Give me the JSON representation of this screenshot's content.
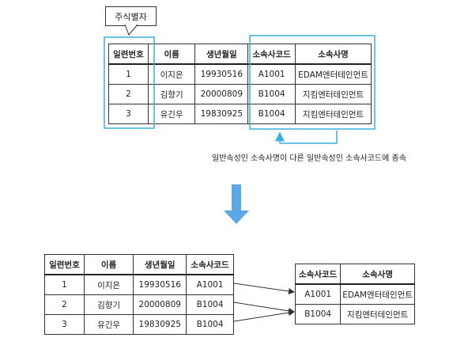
{
  "callout_label": "주식별자",
  "dependency_note": "일반속성인 소속사명이 다른 일반속성인 소속사코드에 종속",
  "colors": {
    "highlight": "#3ab0e0",
    "arrow": "#5aa9e6",
    "line": "#333333"
  },
  "icons": {
    "transform_arrow": "arrow-down-icon"
  },
  "top_table": {
    "headers": [
      "일련번호",
      "이름",
      "생년월일",
      "소속사코드",
      "소속사명"
    ],
    "rows": [
      [
        "1",
        "이지은",
        "19930516",
        "A1001",
        "EDAM엔터테인먼트"
      ],
      [
        "2",
        "김향기",
        "20000809",
        "B1004",
        "지킴엔터테인먼트"
      ],
      [
        "3",
        "유긴우",
        "19830925",
        "B1004",
        "지킴엔터테인먼트"
      ]
    ]
  },
  "bottom_left_table": {
    "headers": [
      "일련번호",
      "이름",
      "생년월일",
      "소속사코드"
    ],
    "rows": [
      [
        "1",
        "이지은",
        "19930516",
        "A1001"
      ],
      [
        "2",
        "김향기",
        "20000809",
        "B1004"
      ],
      [
        "3",
        "유긴우",
        "19830925",
        "B1004"
      ]
    ]
  },
  "bottom_right_table": {
    "headers": [
      "소속사코드",
      "소속사명"
    ],
    "rows": [
      [
        "A1001",
        "EDAM엔터테인먼트"
      ],
      [
        "B1004",
        "지킴엔터테인먼트"
      ]
    ]
  }
}
